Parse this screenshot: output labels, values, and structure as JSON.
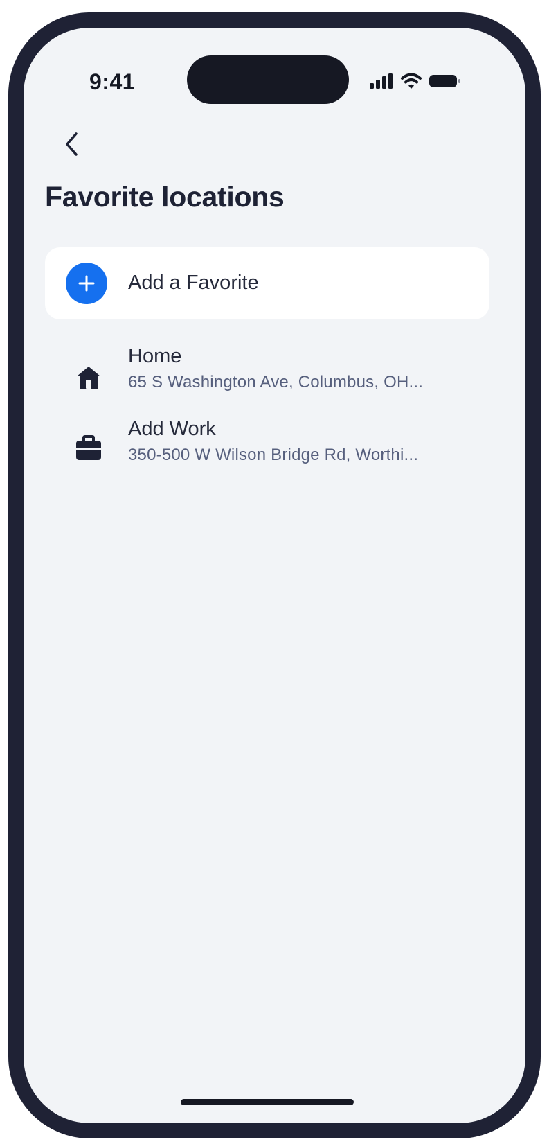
{
  "status_bar": {
    "time": "9:41",
    "icons": [
      "signal-icon",
      "wifi-icon",
      "battery-icon"
    ]
  },
  "header": {
    "back_icon": "chevron-left-icon",
    "title": "Favorite locations"
  },
  "add_favorite": {
    "icon": "plus-icon",
    "label": "Add a Favorite"
  },
  "favorites": [
    {
      "icon": "home-icon",
      "name": "Home",
      "address": "65 S Washington Ave, Columbus, OH..."
    },
    {
      "icon": "briefcase-icon",
      "name": "Add Work",
      "address": "350-500 W Wilson Bridge Rd, Worthi..."
    }
  ],
  "colors": {
    "device_frame": "#1f2235",
    "screen_background": "#f2f4f7",
    "accent": "#1570ef",
    "text_primary": "#1e2235",
    "text_secondary": "#565f7d"
  }
}
